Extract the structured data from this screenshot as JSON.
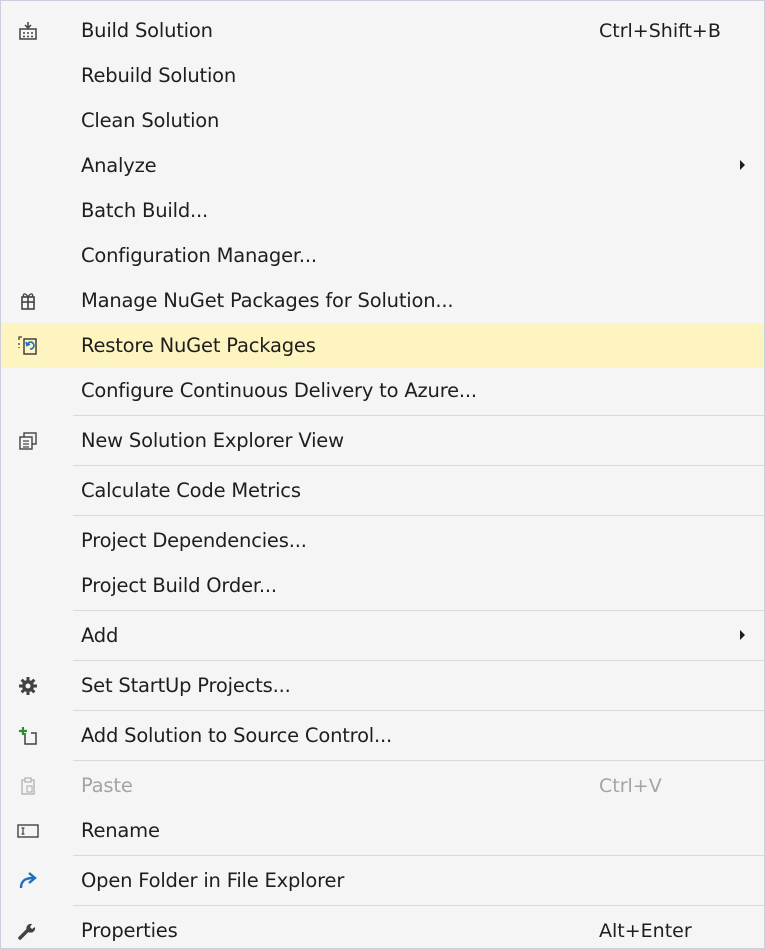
{
  "menu": {
    "items": [
      {
        "label": "Build Solution",
        "shortcut": "Ctrl+Shift+B",
        "icon": "build-solution-icon"
      },
      {
        "label": "Rebuild Solution"
      },
      {
        "label": "Clean Solution"
      },
      {
        "label": "Analyze",
        "submenu": true
      },
      {
        "label": "Batch Build..."
      },
      {
        "label": "Configuration Manager..."
      },
      {
        "label": "Manage NuGet Packages for Solution...",
        "icon": "nuget-package-icon"
      },
      {
        "label": "Restore NuGet Packages",
        "icon": "restore-packages-icon",
        "highlighted": true
      },
      {
        "label": "Configure Continuous Delivery to Azure..."
      },
      {
        "label": "New Solution Explorer View",
        "icon": "new-solution-explorer-icon"
      },
      {
        "label": "Calculate Code Metrics"
      },
      {
        "label": "Project Dependencies..."
      },
      {
        "label": "Project Build Order..."
      },
      {
        "label": "Add",
        "submenu": true
      },
      {
        "label": "Set StartUp Projects...",
        "icon": "gear-icon"
      },
      {
        "label": "Add Solution to Source Control...",
        "icon": "add-source-control-icon"
      },
      {
        "label": "Paste",
        "shortcut": "Ctrl+V",
        "icon": "paste-icon",
        "disabled": true
      },
      {
        "label": "Rename",
        "icon": "rename-icon"
      },
      {
        "label": "Open Folder in File Explorer",
        "icon": "open-folder-arrow-icon"
      },
      {
        "label": "Properties",
        "shortcut": "Alt+Enter",
        "icon": "wrench-icon"
      }
    ]
  }
}
